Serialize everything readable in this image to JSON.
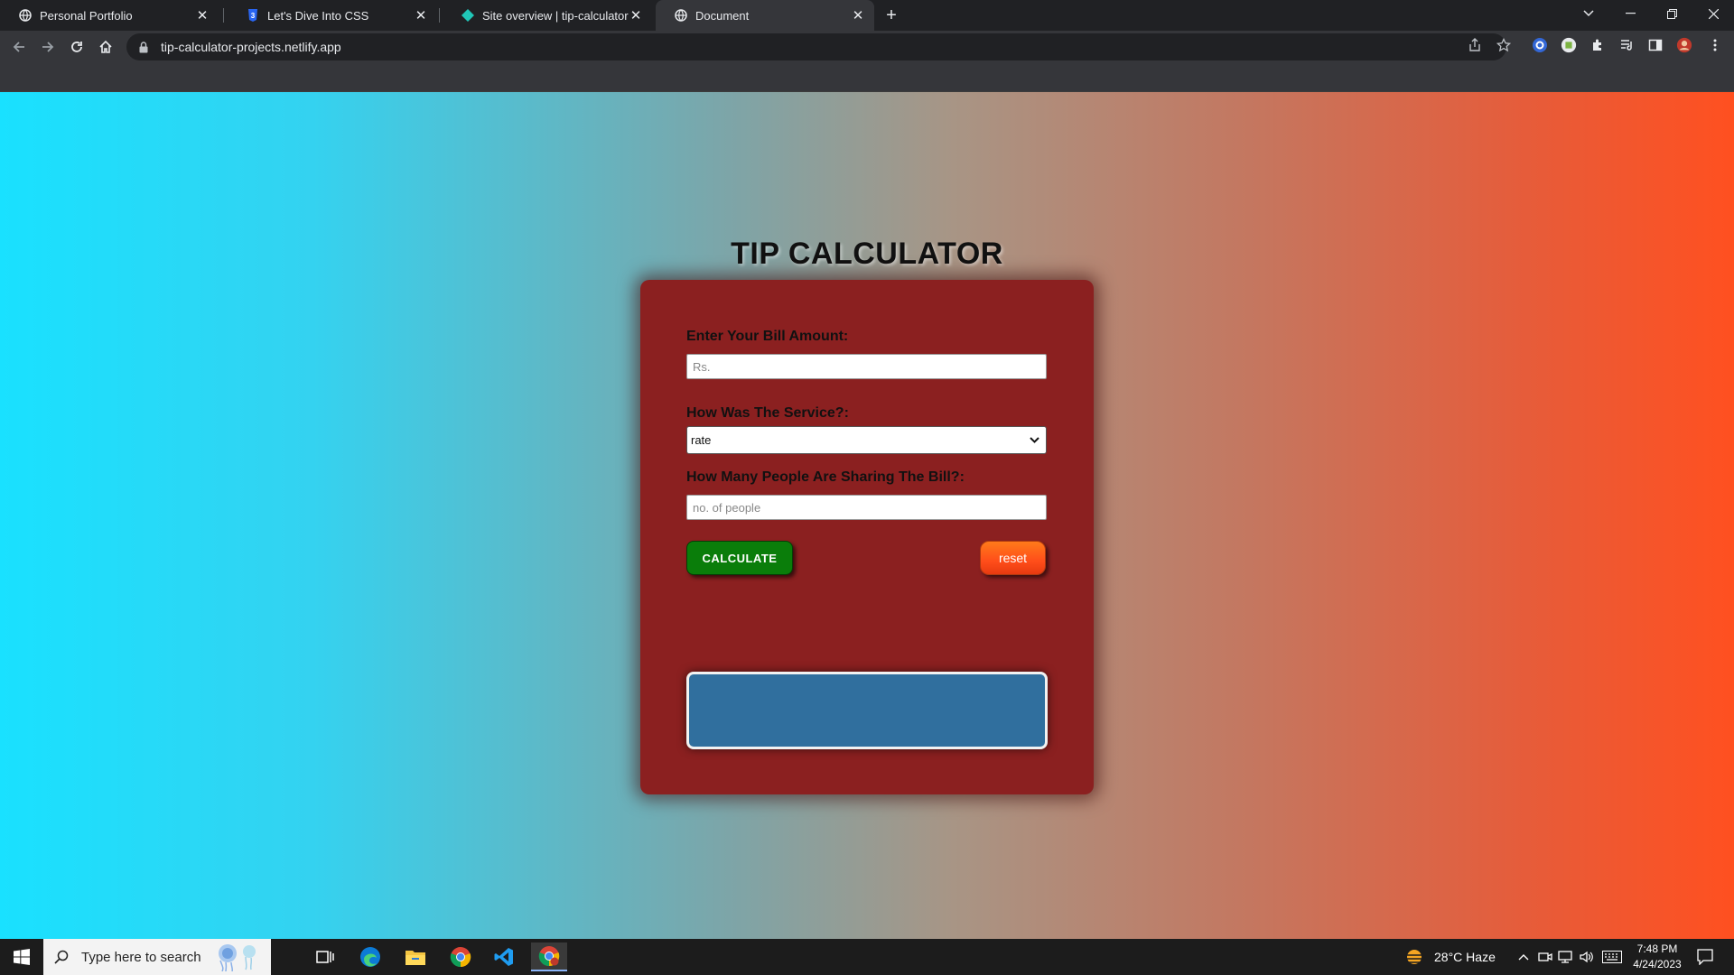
{
  "browser": {
    "tabs": [
      {
        "title": "Personal Portfolio",
        "icon": "globe-icon",
        "active": false
      },
      {
        "title": "Let's Dive Into CSS",
        "icon": "css3-icon",
        "active": false
      },
      {
        "title": "Site overview | tip-calculator-proj",
        "icon": "netlify-icon",
        "active": false
      },
      {
        "title": "Document",
        "icon": "globe-icon",
        "active": true
      }
    ],
    "url": "tip-calculator-projects.netlify.app"
  },
  "page": {
    "title": "TIP CALCULATOR",
    "bill_label": "Enter Your Bill Amount:",
    "bill_placeholder": "Rs.",
    "service_label": "How Was The Service?:",
    "service_selected": "rate",
    "people_label": "How Many People Are Sharing The Bill?:",
    "people_placeholder": "no. of people",
    "calculate_label": "CALCULATE",
    "reset_label": "reset",
    "result_text": ""
  },
  "taskbar": {
    "search_placeholder": "Type here to search",
    "weather": "28°C  Haze",
    "time": "7:48 PM",
    "date": "4/24/2023"
  },
  "colors": {
    "card": "#8b2020",
    "calculate_button": "#0a7d0a",
    "reset_button": "#ff5a1a",
    "result_box": "#306f9e"
  }
}
